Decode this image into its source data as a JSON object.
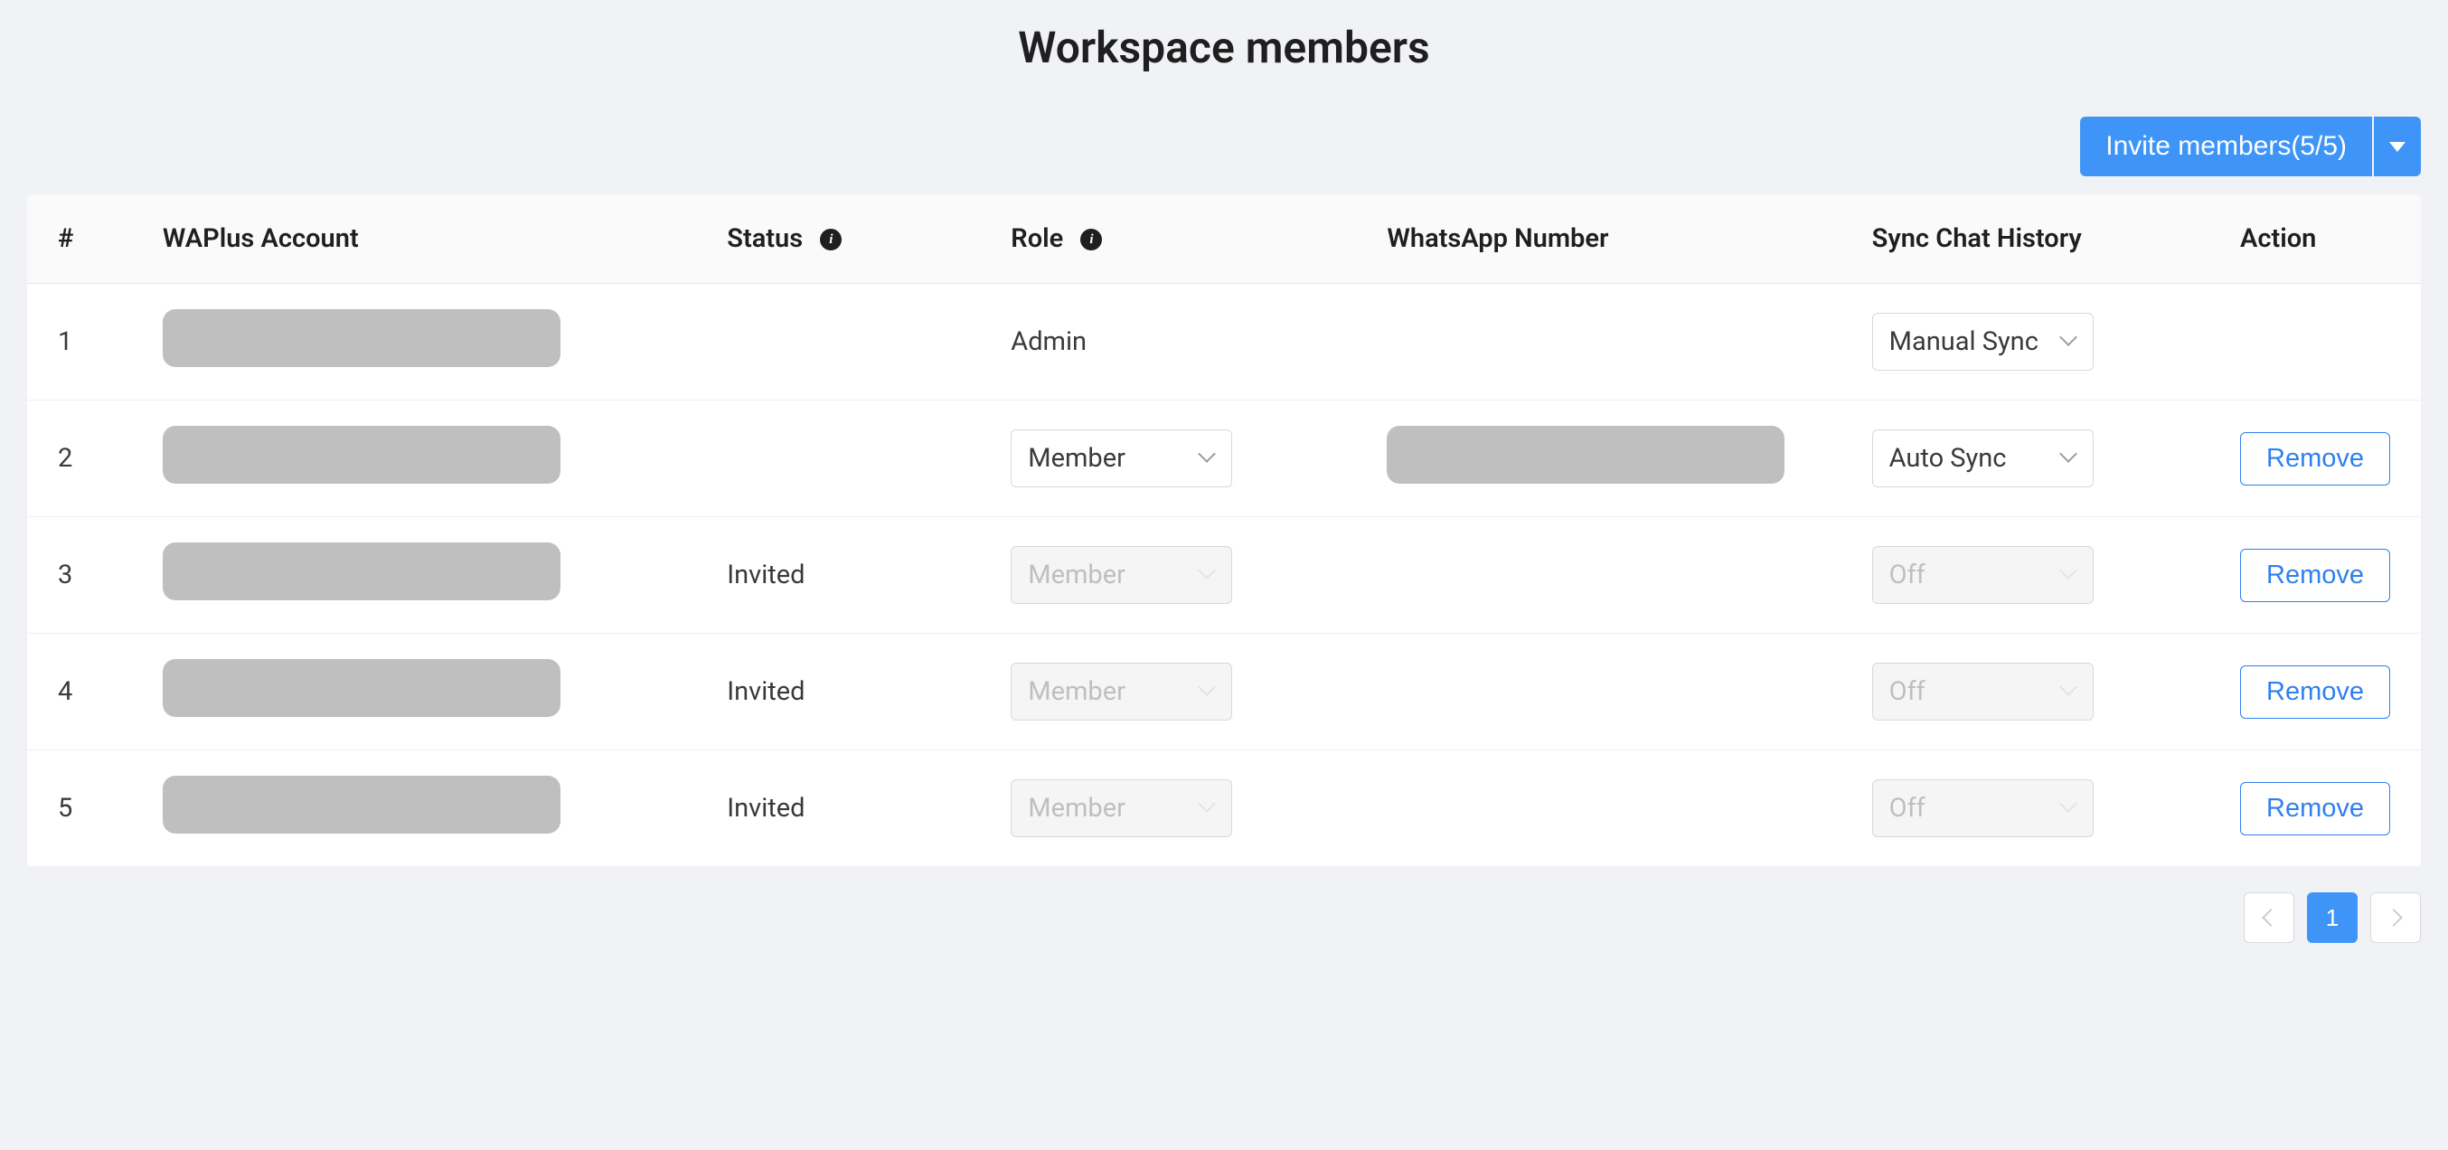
{
  "title": "Workspace members",
  "invite_label": "Invite members(5/5)",
  "columns": {
    "num": "#",
    "account": "WAPlus Account",
    "status": "Status",
    "role": "Role",
    "whatsapp": "WhatsApp Number",
    "sync": "Sync Chat History",
    "action": "Action"
  },
  "rows": [
    {
      "num": "1",
      "status": "",
      "role_kind": "text",
      "role": "Admin",
      "whatsapp_redacted": false,
      "sync": "Manual Sync",
      "sync_disabled": false,
      "removable": false
    },
    {
      "num": "2",
      "status": "",
      "role_kind": "select",
      "role": "Member",
      "whatsapp_redacted": true,
      "sync": "Auto Sync",
      "sync_disabled": false,
      "removable": true
    },
    {
      "num": "3",
      "status": "Invited",
      "role_kind": "select_disabled",
      "role": "Member",
      "whatsapp_redacted": false,
      "sync": "Off",
      "sync_disabled": true,
      "removable": true
    },
    {
      "num": "4",
      "status": "Invited",
      "role_kind": "select_disabled",
      "role": "Member",
      "whatsapp_redacted": false,
      "sync": "Off",
      "sync_disabled": true,
      "removable": true
    },
    {
      "num": "5",
      "status": "Invited",
      "role_kind": "select_disabled",
      "role": "Member",
      "whatsapp_redacted": false,
      "sync": "Off",
      "sync_disabled": true,
      "removable": true
    }
  ],
  "remove_label": "Remove",
  "pagination": {
    "current": "1"
  }
}
